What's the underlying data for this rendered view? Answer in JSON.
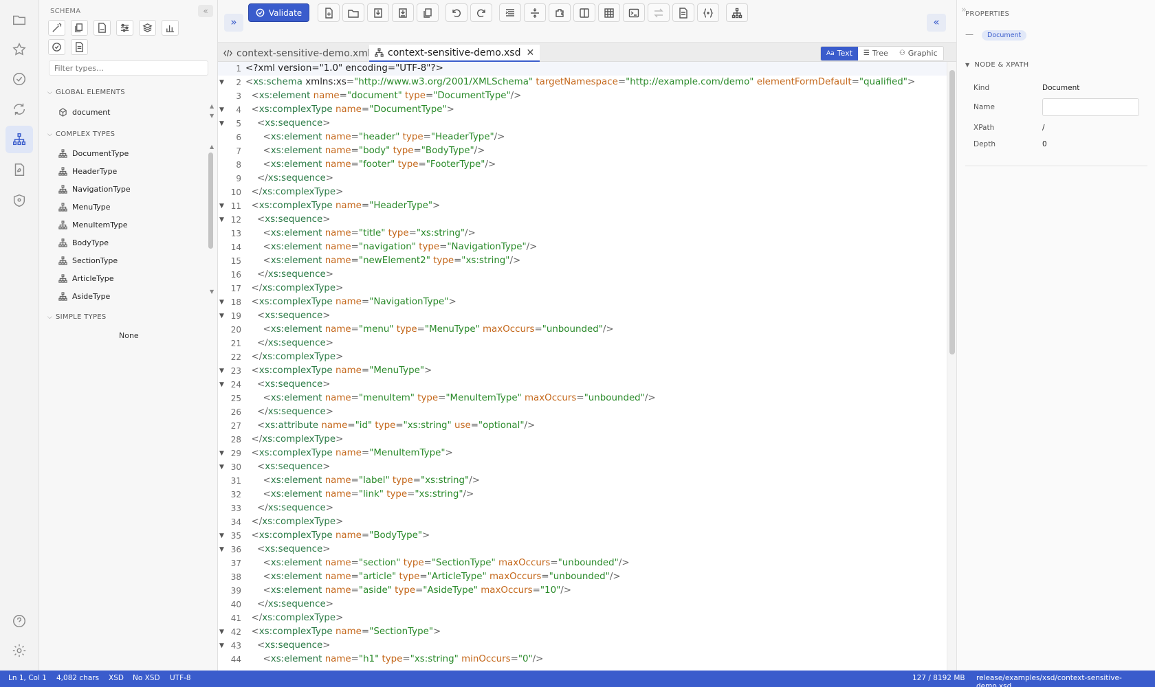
{
  "activity": {
    "items": [
      {
        "name": "folder-icon"
      },
      {
        "name": "star-icon"
      },
      {
        "name": "check-circle-icon"
      },
      {
        "name": "sync-icon"
      },
      {
        "name": "schema-tree-icon"
      },
      {
        "name": "pdf-icon"
      },
      {
        "name": "shield-icon"
      },
      {
        "name": "help-icon"
      },
      {
        "name": "settings-icon"
      }
    ],
    "active": "schema-tree-icon"
  },
  "sidebar": {
    "title": "SCHEMA",
    "filter_placeholder": "Filter types…",
    "global_elements_label": "GLOBAL ELEMENTS",
    "global_elements": [
      "document"
    ],
    "complex_types_label": "COMPLEX TYPES",
    "complex_types": [
      "DocumentType",
      "HeaderType",
      "NavigationType",
      "MenuType",
      "MenuItemType",
      "BodyType",
      "SectionType",
      "ArticleType",
      "AsideType"
    ],
    "simple_types_label": "SIMPLE TYPES",
    "simple_types_empty": "None"
  },
  "toolbar": {
    "validate_label": "Validate"
  },
  "tabs": [
    {
      "label": "context-sensitive-demo.xml",
      "icon": "code-icon",
      "active": false
    },
    {
      "label": "context-sensitive-demo.xsd",
      "icon": "schema-tree-icon",
      "active": true
    }
  ],
  "view_switch": {
    "text": "Text",
    "tree": "Tree",
    "graphic": "Graphic",
    "active": "Text"
  },
  "editor": {
    "lines": [
      "<?xml version=\"1.0\" encoding=\"UTF-8\"?>",
      "<xs:schema xmlns:xs=\"http://www.w3.org/2001/XMLSchema\" targetNamespace=\"http://example.com/demo\" elementFormDefault=\"qualified\">",
      "  <xs:element name=\"document\" type=\"DocumentType\"/>",
      "  <xs:complexType name=\"DocumentType\">",
      "    <xs:sequence>",
      "      <xs:element name=\"header\" type=\"HeaderType\"/>",
      "      <xs:element name=\"body\" type=\"BodyType\"/>",
      "      <xs:element name=\"footer\" type=\"FooterType\"/>",
      "    </xs:sequence>",
      "  </xs:complexType>",
      "  <xs:complexType name=\"HeaderType\">",
      "    <xs:sequence>",
      "      <xs:element name=\"title\" type=\"xs:string\"/>",
      "      <xs:element name=\"navigation\" type=\"NavigationType\"/>",
      "      <xs:element name=\"newElement2\" type=\"xs:string\"/>",
      "    </xs:sequence>",
      "  </xs:complexType>",
      "  <xs:complexType name=\"NavigationType\">",
      "    <xs:sequence>",
      "      <xs:element name=\"menu\" type=\"MenuType\" maxOccurs=\"unbounded\"/>",
      "    </xs:sequence>",
      "  </xs:complexType>",
      "  <xs:complexType name=\"MenuType\">",
      "    <xs:sequence>",
      "      <xs:element name=\"menuItem\" type=\"MenuItemType\" maxOccurs=\"unbounded\"/>",
      "    </xs:sequence>",
      "    <xs:attribute name=\"id\" type=\"xs:string\" use=\"optional\"/>",
      "  </xs:complexType>",
      "  <xs:complexType name=\"MenuItemType\">",
      "    <xs:sequence>",
      "      <xs:element name=\"label\" type=\"xs:string\"/>",
      "      <xs:element name=\"link\" type=\"xs:string\"/>",
      "    </xs:sequence>",
      "  </xs:complexType>",
      "  <xs:complexType name=\"BodyType\">",
      "    <xs:sequence>",
      "      <xs:element name=\"section\" type=\"SectionType\" maxOccurs=\"unbounded\"/>",
      "      <xs:element name=\"article\" type=\"ArticleType\" maxOccurs=\"unbounded\"/>",
      "      <xs:element name=\"aside\" type=\"AsideType\" maxOccurs=\"10\"/>",
      "    </xs:sequence>",
      "  </xs:complexType>",
      "  <xs:complexType name=\"SectionType\">",
      "    <xs:sequence>",
      "      <xs:element name=\"h1\" type=\"xs:string\" minOccurs=\"0\"/>"
    ],
    "fold_lines": [
      2,
      4,
      5,
      11,
      12,
      18,
      19,
      23,
      24,
      29,
      30,
      35,
      36,
      42,
      43
    ]
  },
  "properties": {
    "title": "PROPERTIES",
    "badge": "Document",
    "section": "NODE & XPATH",
    "kind_label": "Kind",
    "kind_value": "Document",
    "name_label": "Name",
    "name_value": "",
    "xpath_label": "XPath",
    "xpath_value": "/",
    "depth_label": "Depth",
    "depth_value": "0"
  },
  "status": {
    "position": "Ln 1, Col 1",
    "chars": "4,082 chars",
    "lang": "XSD",
    "schema": "No XSD",
    "encoding": "UTF-8",
    "memory": "127 / 8192 MB",
    "path": "release/examples/xsd/context-sensitive-demo.xsd"
  },
  "colors": {
    "accent": "#3a5ccc",
    "tag": "#2a7a45",
    "attr": "#c4671a",
    "value": "#2a8a2a"
  }
}
